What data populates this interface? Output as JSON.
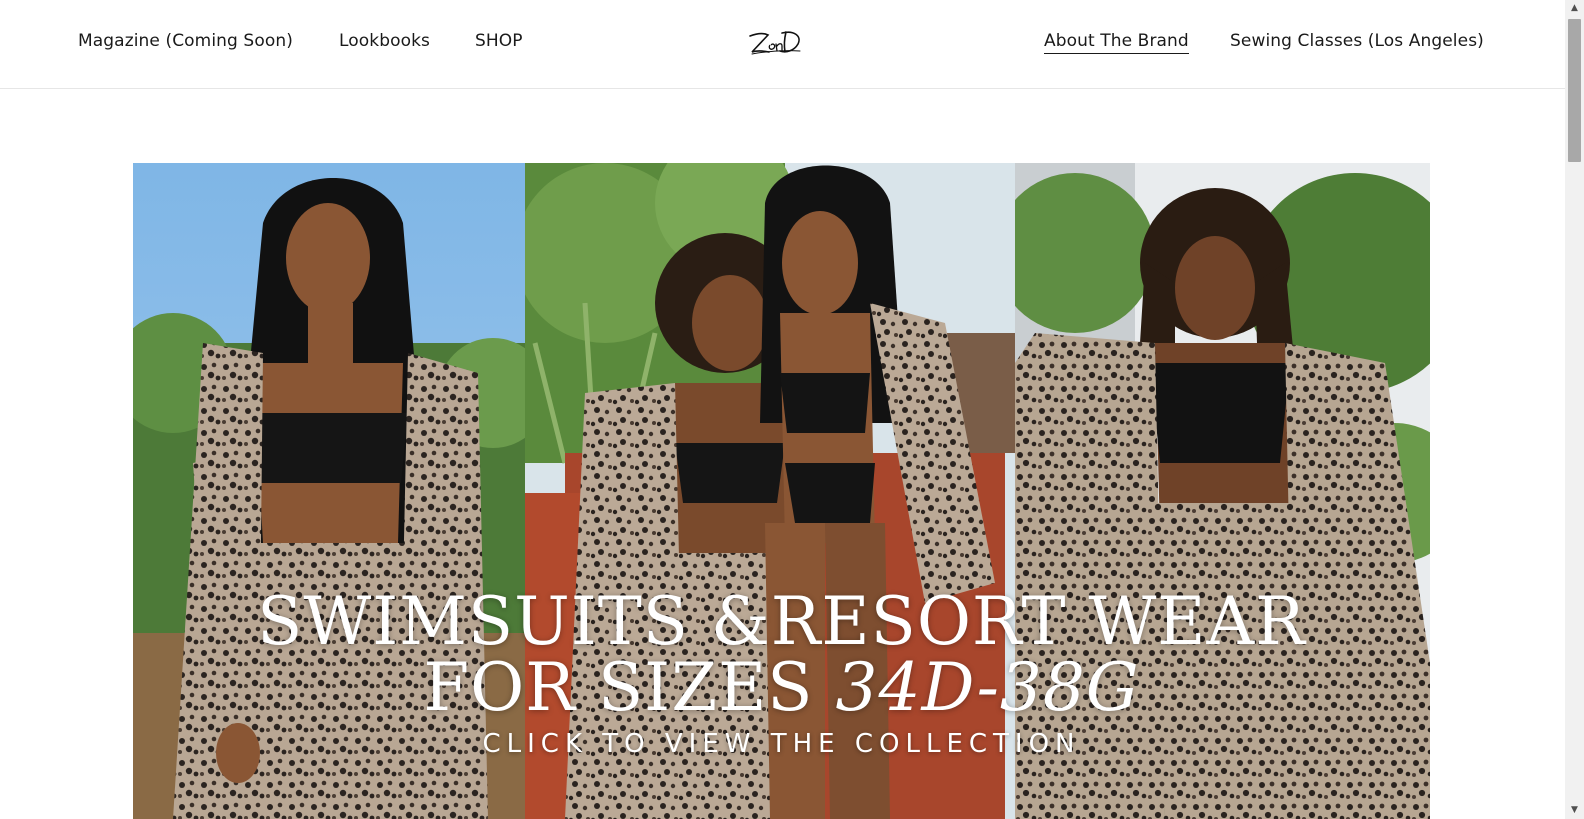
{
  "header": {
    "nav_left": [
      "Magazine (Coming Soon)",
      "Lookbooks",
      "SHOP"
    ],
    "logo_text": "ZonD",
    "nav_right": [
      "About The Brand",
      "Sewing Classes (Los Angeles)"
    ],
    "active_item": "About The Brand"
  },
  "hero": {
    "headline_line1": "SWIMSUITS &RESORT WEAR",
    "headline_line2_prefix": "FOR SIZES",
    "headline_line2_emphasis": "34D-38G",
    "cta": "CLICK TO VIEW THE COLLECTION"
  },
  "colors": {
    "text": "#1a1a1a",
    "hero_text": "#ffffff",
    "header_border": "#e6e6e6",
    "scrollbar_track": "#f1f1f1",
    "scrollbar_thumb": "#a8a8a8"
  },
  "scrollbar": {
    "up_icon": "triangle-up-icon",
    "down_icon": "triangle-down-icon"
  }
}
